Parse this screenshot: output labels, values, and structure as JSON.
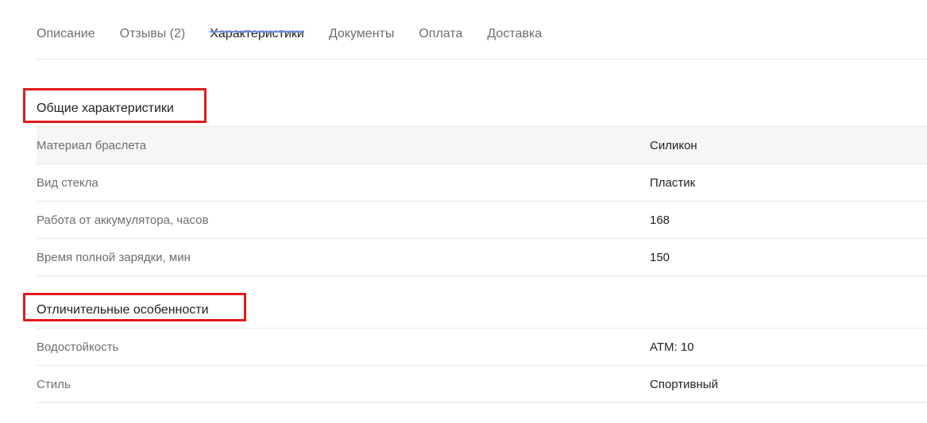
{
  "tabs": [
    {
      "label": "Описание",
      "active": false
    },
    {
      "label": "Отзывы (2)",
      "active": false
    },
    {
      "label": "Характеристики",
      "active": true
    },
    {
      "label": "Документы",
      "active": false
    },
    {
      "label": "Оплата",
      "active": false
    },
    {
      "label": "Доставка",
      "active": false
    }
  ],
  "sections": [
    {
      "title": "Общие характеристики",
      "rows": [
        {
          "name": "Материал браслета",
          "value": "Силикон"
        },
        {
          "name": "Вид стекла",
          "value": "Пластик"
        },
        {
          "name": "Работа от аккумулятора, часов",
          "value": "168"
        },
        {
          "name": "Время полной зарядки, мин",
          "value": "150"
        }
      ]
    },
    {
      "title": "Отличительные особенности",
      "rows": [
        {
          "name": "Водостойкость",
          "value": "ATM: 10"
        },
        {
          "name": "Стиль",
          "value": "Спортивный"
        }
      ]
    }
  ],
  "colors": {
    "accent": "#6b8fe6",
    "highlight": "#e01b1b",
    "muted_text": "#6e6e6e",
    "text": "#222222",
    "divider": "#e8e8e8",
    "row_shade": "#f6f6f6"
  }
}
